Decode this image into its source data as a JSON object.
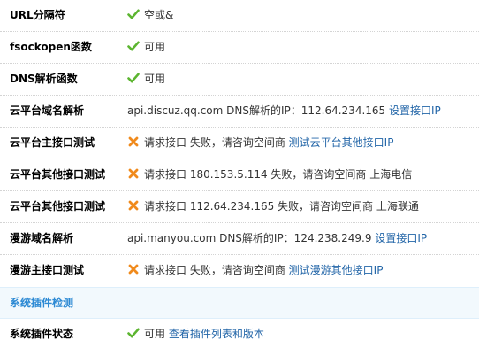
{
  "colors": {
    "ok_green": "#5cb530",
    "fail_orange": "#f08a1c",
    "link_blue": "#2366a8",
    "section_bg": "#f2f9fd",
    "section_title": "#2d8ad4"
  },
  "rows": {
    "url_sep": {
      "label": "URL分隔符",
      "status_icon": "check-icon",
      "value": "空或&"
    },
    "fsockopen": {
      "label": "fsockopen函数",
      "status_icon": "check-icon",
      "value": "可用"
    },
    "dns_func": {
      "label": "DNS解析函数",
      "status_icon": "check-icon",
      "value": "可用"
    },
    "cloud_dns": {
      "label": "云平台域名解析",
      "value": "api.discuz.qq.com DNS解析的IP：112.64.234.165",
      "link": "设置接口IP"
    },
    "cloud_main": {
      "label": "云平台主接口测试",
      "status_icon": "cross-icon",
      "value": "请求接口 失败，请咨询空间商",
      "link": "测试云平台其他接口IP"
    },
    "cloud_other_1": {
      "label": "云平台其他接口测试",
      "status_icon": "cross-icon",
      "value": "请求接口 180.153.5.114 失败，请咨询空间商 上海电信"
    },
    "cloud_other_2": {
      "label": "云平台其他接口测试",
      "status_icon": "cross-icon",
      "value": "请求接口 112.64.234.165 失败，请咨询空间商 上海联通"
    },
    "manyou_dns": {
      "label": "漫游域名解析",
      "value": "api.manyou.com DNS解析的IP：124.238.249.9",
      "link": "设置接口IP"
    },
    "manyou_main": {
      "label": "漫游主接口测试",
      "status_icon": "cross-icon",
      "value": "请求接口 失败，请咨询空间商",
      "link": "测试漫游其他接口IP"
    }
  },
  "section": {
    "title": "系统插件检测"
  },
  "plugin_status": {
    "label": "系统插件状态",
    "status_icon": "check-icon",
    "value": "可用",
    "link": "查看插件列表和版本"
  }
}
